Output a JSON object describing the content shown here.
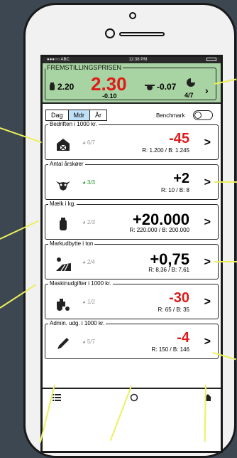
{
  "status_bar": {
    "carrier": "●●●○○ ABC",
    "time": "12:38 PM"
  },
  "price_panel": {
    "title": "FREMSTILLINGSPRISEN",
    "left_value": "2.20",
    "main_value": "2.30",
    "main_delta": "-0.10",
    "right_value": "-0.07",
    "fraction": "4/7"
  },
  "period_tabs": [
    "Dag",
    "Mdr",
    "År"
  ],
  "active_tab": "Mdr",
  "benchmark_label": "Benchmark",
  "cards": [
    {
      "title": "Bedriften i 1000 kr.",
      "score": "6/7",
      "value": "-45",
      "detail": "R: 1.200 / B: 1.245",
      "icon": "barn-icon",
      "negative": true
    },
    {
      "title": "Antal årskøer",
      "score": "3/3",
      "value": "+2",
      "detail": "R: 10 / B: 8",
      "icon": "cow-icon",
      "negative": false,
      "good": true
    },
    {
      "title": "Mælk i kg.",
      "score": "2/3",
      "value": "+20.000",
      "detail": "R: 220.000 / B: 200.000",
      "icon": "milk-can-icon",
      "negative": false
    },
    {
      "title": "Markudbytte i ton",
      "score": "2/4",
      "value": "+0,75",
      "detail": "R: 8,36 / B: 7,61",
      "icon": "field-icon",
      "negative": false
    },
    {
      "title": "Maskinudgifter i 1000 kr.",
      "score": "1/2",
      "value": "-30",
      "detail": "R: 65 / B: 35",
      "icon": "tractor-icon",
      "negative": true
    },
    {
      "title": "Admin. udg. i 1000 kr.",
      "score": "5/7",
      "value": "-4",
      "detail": "R: 150 / B: 146",
      "icon": "pencil-icon",
      "negative": true
    }
  ],
  "nav_icons": [
    "list-icon",
    "circle-icon",
    "home-icon"
  ],
  "colors": {
    "accent_green": "#a8d3a2",
    "negative_red": "#e01b1b",
    "good_green": "#1e9b24",
    "highlight": "#ecf05b"
  }
}
